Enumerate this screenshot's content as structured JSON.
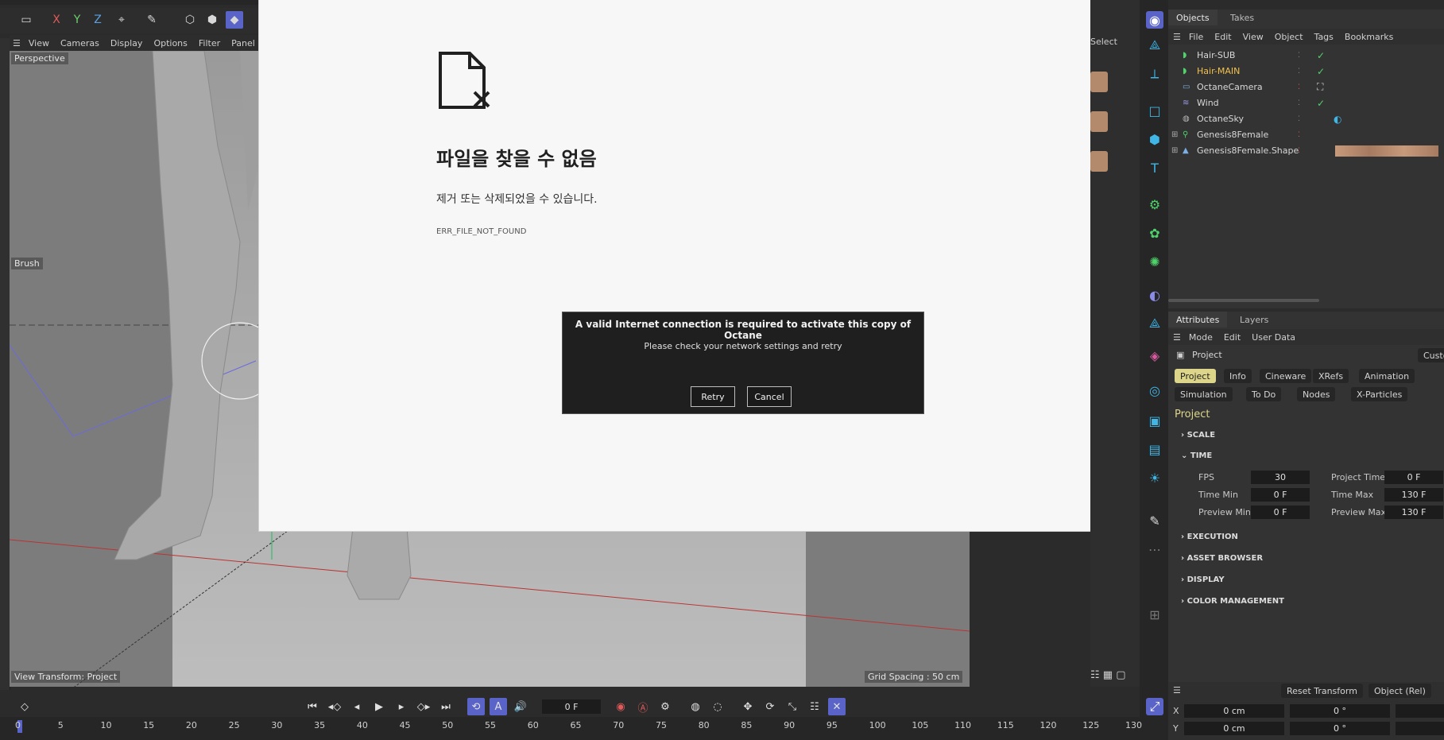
{
  "viewport": {
    "menu": [
      "View",
      "Cameras",
      "Display",
      "Options",
      "Filter",
      "Panel"
    ],
    "camera_label": "Perspective",
    "brush_label": "Brush",
    "view_transform": "View Transform: Project",
    "grid_spacing": "Grid Spacing : 50 cm",
    "axis_buttons": [
      "X",
      "Y",
      "Z"
    ]
  },
  "error_page": {
    "title": "파일을 찾을 수 없음",
    "description": "제거 또는 삭제되었을 수 있습니다.",
    "code": "ERR_FILE_NOT_FOUND"
  },
  "dialog": {
    "title": "A valid Internet connection is required to activate this copy of Octane",
    "message": "Please check your network settings and retry",
    "retry_label": "Retry",
    "cancel_label": "Cancel"
  },
  "side_label": "Select",
  "objects_panel": {
    "tabs": [
      "Objects",
      "Takes"
    ],
    "menu": [
      "File",
      "Edit",
      "View",
      "Object",
      "Tags",
      "Bookmarks"
    ],
    "items": [
      {
        "name": "Hair-SUB",
        "highlight": false
      },
      {
        "name": "Hair-MAIN",
        "highlight": true
      },
      {
        "name": "OctaneCamera",
        "highlight": false
      },
      {
        "name": "Wind",
        "highlight": false
      },
      {
        "name": "OctaneSky",
        "highlight": false
      },
      {
        "name": "Genesis8Female",
        "highlight": false
      },
      {
        "name": "Genesis8Female.Shape",
        "highlight": false
      }
    ]
  },
  "attributes_panel": {
    "tabs": [
      "Attributes",
      "Layers"
    ],
    "menu": [
      "Mode",
      "Edit",
      "User Data"
    ],
    "object_label": "Project",
    "custom_label": "Custo",
    "pills_row1": [
      "Project",
      "Info",
      "Cineware",
      "XRefs",
      "Animation"
    ],
    "pills_row2": [
      "Simulation",
      "To Do",
      "Nodes",
      "X-Particles"
    ],
    "section_title": "Project",
    "sections": [
      "SCALE",
      "TIME",
      "EXECUTION",
      "ASSET BROWSER",
      "DISPLAY",
      "COLOR MANAGEMENT"
    ],
    "time_fields": {
      "fps_label": "FPS",
      "fps": "30",
      "project_time_label": "Project Time",
      "project_time": "0 F",
      "time_min_label": "Time Min",
      "time_min": "0 F",
      "time_max_label": "Time Max",
      "time_max": "130 F",
      "preview_min_label": "Preview Min",
      "preview_min": "0 F",
      "preview_max_label": "Preview Max",
      "preview_max": "130 F"
    }
  },
  "coord_panel": {
    "reset_label": "Reset Transform",
    "mode_label": "Object (Rel)",
    "rows": [
      {
        "axis": "X",
        "pos": "0 cm",
        "rot": "0 °"
      },
      {
        "axis": "Y",
        "pos": "0 cm",
        "rot": "0 °"
      }
    ]
  },
  "timeline": {
    "current_frame": "0 F",
    "ticks": [
      "0",
      "5",
      "10",
      "15",
      "20",
      "25",
      "30",
      "35",
      "40",
      "45",
      "50",
      "55",
      "60",
      "65",
      "70",
      "75",
      "80",
      "85",
      "90",
      "95",
      "100",
      "105",
      "110",
      "115",
      "120",
      "125",
      "130"
    ]
  },
  "colors": {
    "accent": "#5a64c8",
    "highlight_text": "#f2c24a",
    "active_pill": "#ddd68a",
    "check": "#4fd36b",
    "icon_blue": "#3fb6e6"
  }
}
